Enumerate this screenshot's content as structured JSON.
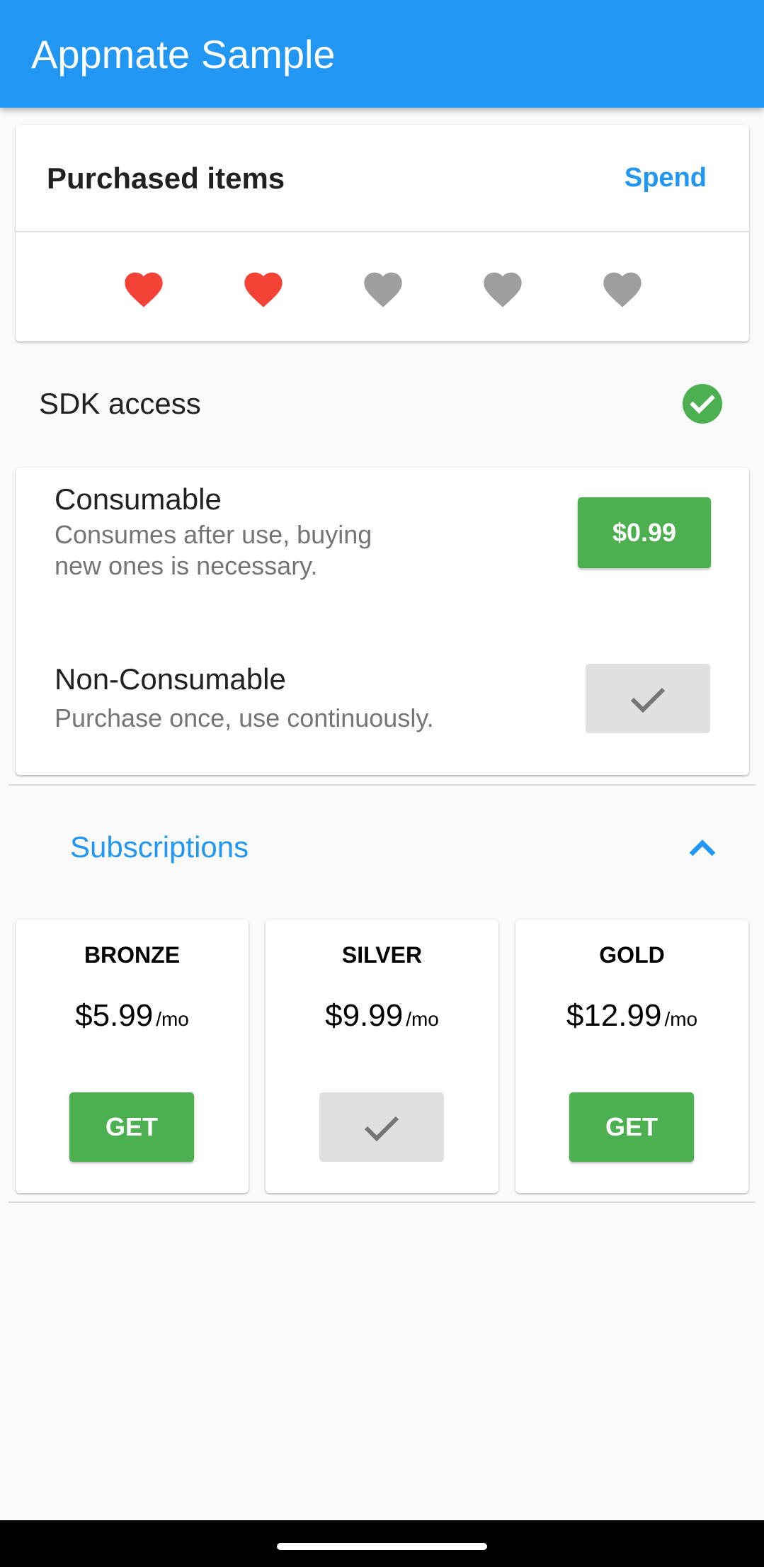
{
  "appbar": {
    "title": "Appmate Sample",
    "color": "#2196f3"
  },
  "purchased": {
    "title": "Purchased items",
    "spend_label": "Spend",
    "hearts": [
      {
        "icon": "heart-icon",
        "filled": true,
        "color": "#f44336"
      },
      {
        "icon": "heart-icon",
        "filled": true,
        "color": "#f44336"
      },
      {
        "icon": "heart-icon",
        "filled": false,
        "color": "#9e9e9e"
      },
      {
        "icon": "heart-icon",
        "filled": false,
        "color": "#9e9e9e"
      },
      {
        "icon": "heart-icon",
        "filled": false,
        "color": "#9e9e9e"
      }
    ]
  },
  "sdk": {
    "label": "SDK access",
    "status_icon": "check-circle-icon",
    "status_color": "#4caf50"
  },
  "products": [
    {
      "title": "Consumable",
      "description": "Consumes after use, buying new ones is necessary.",
      "button_label": "$0.99",
      "purchased": false
    },
    {
      "title": "Non-Consumable",
      "description": "Purchase once, use continuously.",
      "button_label": "",
      "button_icon": "check-icon",
      "purchased": true
    }
  ],
  "subscriptions": {
    "title": "Subscriptions",
    "expanded": true,
    "toggle_icon": "chevron-up-icon",
    "tiers": [
      {
        "name": "BRONZE",
        "price": "$5.99",
        "period": "/mo",
        "button_label": "GET",
        "purchased": false
      },
      {
        "name": "SILVER",
        "price": "$9.99",
        "period": "/mo",
        "button_label": "",
        "button_icon": "check-icon",
        "purchased": true
      },
      {
        "name": "GOLD",
        "price": "$12.99",
        "period": "/mo",
        "button_label": "GET",
        "purchased": false
      }
    ]
  },
  "colors": {
    "accent": "#2196f3",
    "buy_button": "#4caf50",
    "disabled_button": "#e0e0e0",
    "heart_active": "#f44336",
    "heart_inactive": "#9e9e9e"
  }
}
